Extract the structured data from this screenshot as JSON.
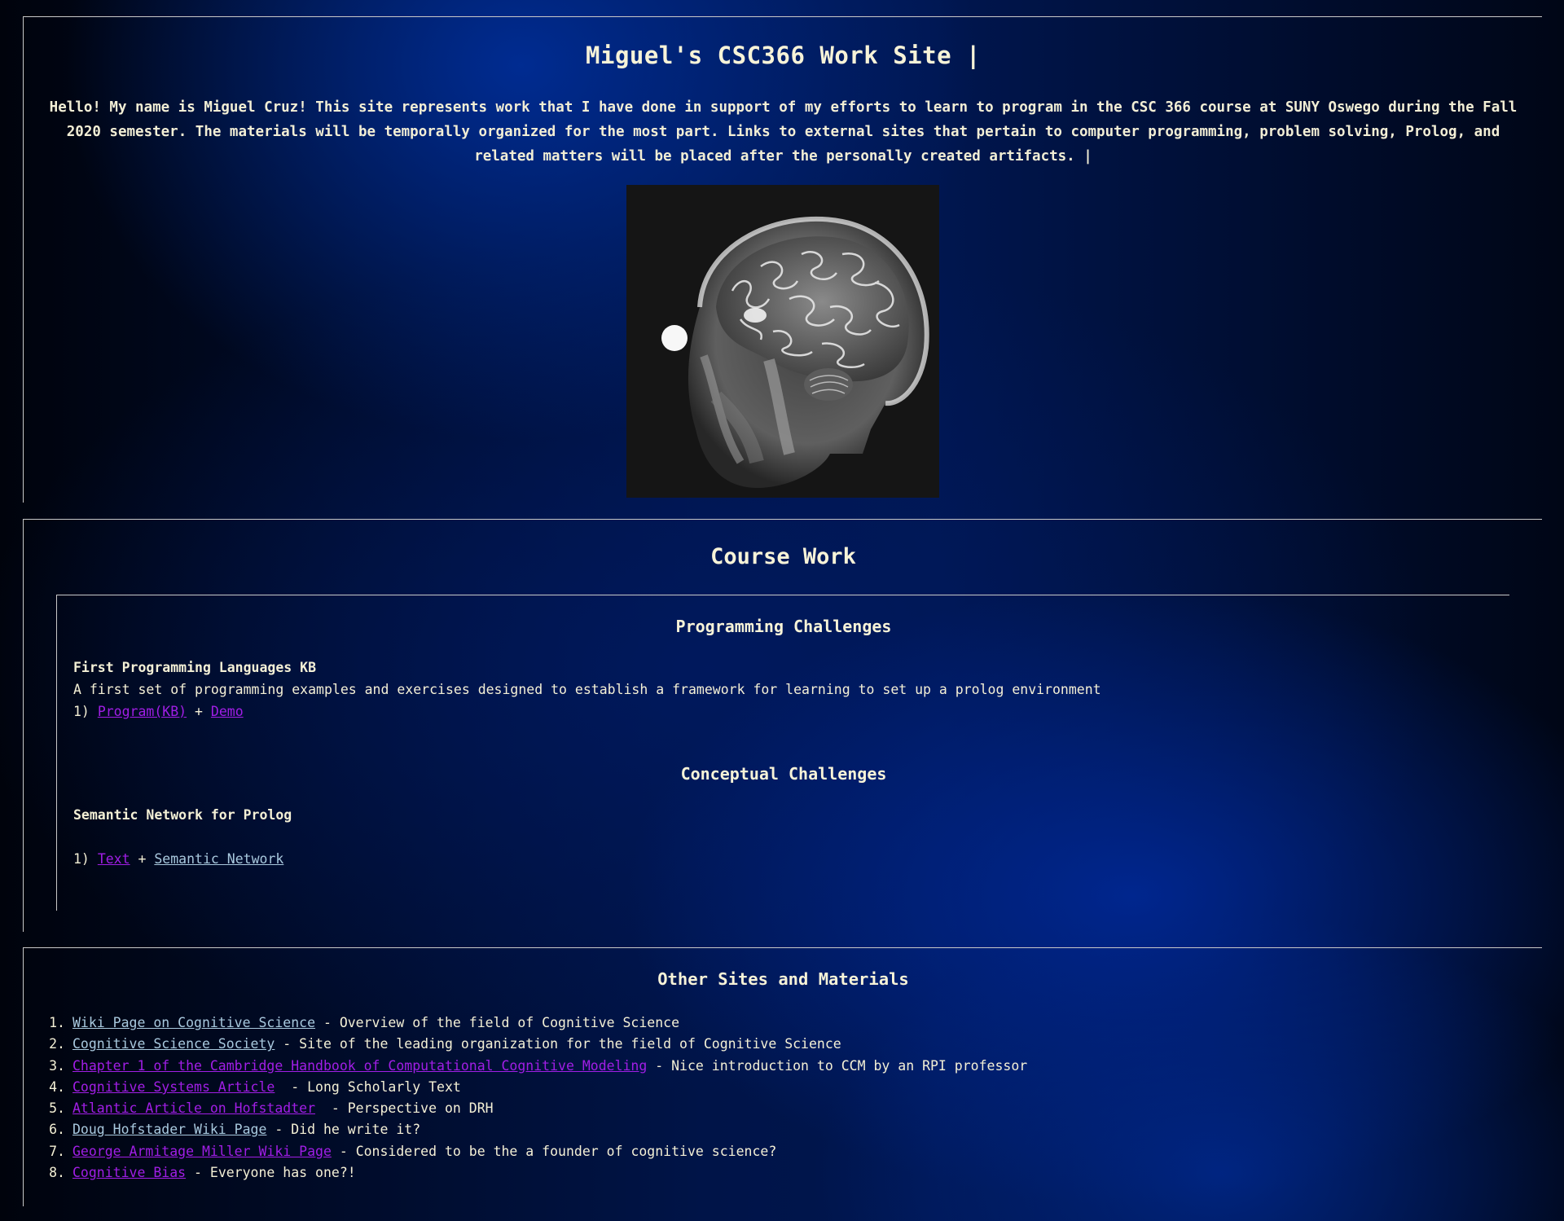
{
  "header": {
    "title": "Miguel's CSC366 Work Site |",
    "intro": "Hello! My name is Miguel Cruz! This site represents work that I have done in support of my efforts to learn to program in the CSC 366 course at SUNY Oswego during the Fall 2020 semester. The materials will be temporally organized for the most part. Links to external sites that pertain to computer programming, problem solving, Prolog, and related matters will be placed after the personally created artifacts. |",
    "image": "brain-mri-image"
  },
  "course_work": {
    "title": "Course Work",
    "programming": {
      "title": "Programming Challenges",
      "item_title": "First Programming Languages KB",
      "item_desc": "A first set of programming examples and exercises designed to establish a framework for learning to set up a prolog environment",
      "prefix": "1)",
      "link1": "Program(KB)",
      "plus": "+",
      "link2": "Demo"
    },
    "conceptual": {
      "title": "Conceptual Challenges",
      "item_title": "Semantic Network for Prolog",
      "prefix": "1)",
      "link1": "Text",
      "plus": "+",
      "link2": "Semantic Network"
    }
  },
  "other": {
    "title": "Other Sites and Materials",
    "items": [
      {
        "num": "1.",
        "link": "Wiki Page on Cognitive Science",
        "desc": " - Overview of the field of Cognitive Science",
        "visited": false
      },
      {
        "num": "2.",
        "link": "Cognitive Science Society",
        "desc": " - Site of the leading organization for the field of Cognitive Science",
        "visited": false
      },
      {
        "num": "3.",
        "link": "Chapter 1 of the Cambridge Handbook of Computational Cognitive Modeling",
        "desc": " - Nice introduction to CCM by an RPI professor",
        "visited": true
      },
      {
        "num": "4.",
        "link": "Cognitive Systems Article",
        "desc": "  - Long Scholarly Text",
        "visited": true
      },
      {
        "num": "5.",
        "link": "Atlantic Article on Hofstadter",
        "desc": "  - Perspective on DRH",
        "visited": true
      },
      {
        "num": "6.",
        "link": "Doug Hofstader Wiki Page",
        "desc": " - Did he write it?",
        "visited": false
      },
      {
        "num": "7.",
        "link": "George Armitage Miller Wiki Page",
        "desc": " - Considered to be the a founder of cognitive science?",
        "visited": true
      },
      {
        "num": "8.",
        "link": "Cognitive Bias",
        "desc": " - Everyone has one?!",
        "visited": true
      }
    ]
  },
  "colors": {
    "text": "#f4f0d6",
    "link_visited": "#a11ee6",
    "link_unvisited": "#a9c9de",
    "rule": "#c9c9c9"
  }
}
